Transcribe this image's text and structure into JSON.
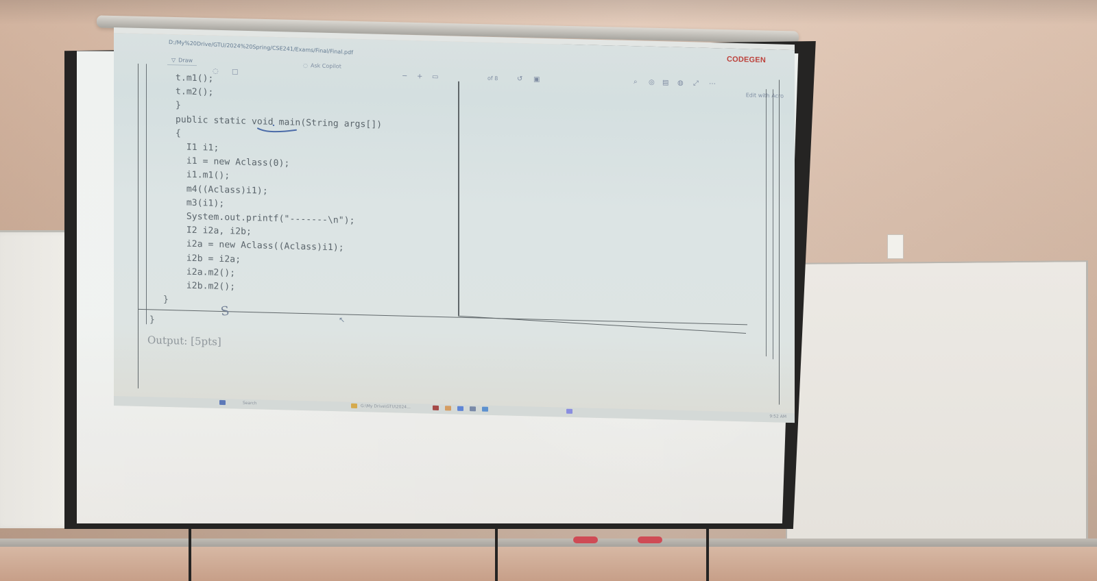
{
  "window": {
    "path": "D:/My%20Drive/GTU/2024%20Spring/CSE241/Exams/Final/Final.pdf",
    "brand": "CODEGEN"
  },
  "toolbar": {
    "draw_label": "Draw",
    "copilot_label": "Ask Copilot",
    "page_count": "of 8",
    "edit_label": "Edit with Acro"
  },
  "document": {
    "code_lines": [
      "t.m1();",
      "t.m2();",
      "}",
      "public static void main(String args[])",
      "{",
      "  I1 i1;",
      "  i1 = new Aclass(0);",
      "  i1.m1();",
      "  m4((Aclass)i1);",
      "  m3(i1);",
      "  System.out.printf(\"-------\\n\");",
      "  I2 i2a, i2b;",
      "  i2a = new Aclass((Aclass)i1);",
      "  i2b = i2a;",
      "  i2a.m2();",
      "  i2b.m2();"
    ],
    "brace_inner": "}",
    "brace_outer": "}",
    "output_label": "Output: [5pts]",
    "handwritten_mark": "S"
  },
  "taskbar": {
    "search": "Search",
    "folder": "G:\\My Drive\\GTU\\2024...",
    "time": "9:52 AM"
  }
}
